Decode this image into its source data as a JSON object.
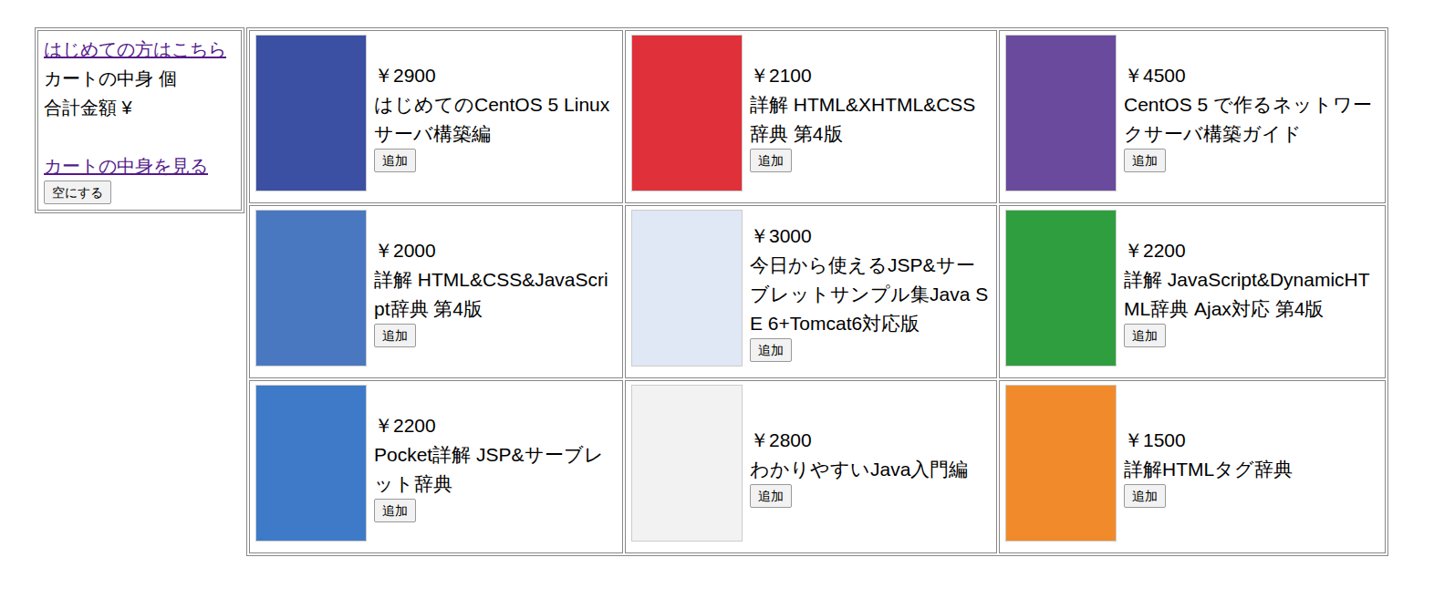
{
  "sidebar": {
    "guide_link": "はじめての方はこちら",
    "cart_count": "カートの中身 個",
    "cart_total": "合計金額 ¥",
    "view_cart_link": "カートの中身を見る",
    "clear_button": "空にする"
  },
  "books": [
    {
      "price": "￥2900",
      "title": "はじめてのCentOS 5 Linuxサーバ構築編",
      "button": "追加",
      "color": "#3b4fa3"
    },
    {
      "price": "￥2100",
      "title": "詳解 HTML&XHTML&CSS辞典 第4版",
      "button": "追加",
      "color": "#e0303a"
    },
    {
      "price": "￥4500",
      "title": "CentOS 5 で作るネットワークサーバ構築ガイド",
      "button": "追加",
      "color": "#6a4a9c"
    },
    {
      "price": "￥2000",
      "title": "詳解 HTML&CSS&JavaScript辞典 第4版",
      "button": "追加",
      "color": "#4a78c0"
    },
    {
      "price": "￥3000",
      "title": "今日から使えるJSP&サーブレットサンプル集Java SE 6+Tomcat6対応版",
      "button": "追加",
      "color": "#dfe8f4"
    },
    {
      "price": "￥2200",
      "title": "詳解 JavaScript&DynamicHTML辞典 Ajax対応 第4版",
      "button": "追加",
      "color": "#2e9e3e"
    },
    {
      "price": "￥2200",
      "title": "Pocket詳解 JSP&サーブレット辞典",
      "button": "追加",
      "color": "#3f7ac8"
    },
    {
      "price": "￥2800",
      "title": "わかりやすいJava入門編",
      "button": "追加",
      "color": "#f2f2f2"
    },
    {
      "price": "￥1500",
      "title": "詳解HTMLタグ辞典",
      "button": "追加",
      "color": "#f08a2a"
    }
  ]
}
